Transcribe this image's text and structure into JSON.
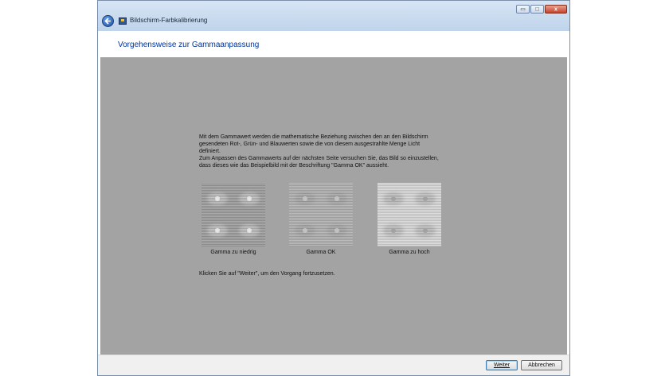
{
  "window": {
    "title": "Bildschirm-Farbkalibrierung",
    "controls": {
      "minimize": "▭",
      "maximize": "□",
      "close": "x"
    }
  },
  "page": {
    "heading": "Vorgehensweise zur Gammaanpassung",
    "description": "Mit dem Gammawert werden die mathematische Beziehung zwischen den an den Bildschirm\ngesendeten Rot-, Grün- und Blauwerten sowie die von diesem ausgestrahlte Menge Licht\ndefiniert.\nZum Anpassen des Gammawerts auf der nächsten Seite versuchen Sie, das Bild so einzustellen,\ndass dieses wie das Beispielbild mit der Beschriftung \"Gamma OK\" aussieht.",
    "samples": [
      {
        "label": "Gamma zu niedrig"
      },
      {
        "label": "Gamma OK"
      },
      {
        "label": "Gamma zu hoch"
      }
    ],
    "hint": "Klicken Sie auf \"Weiter\", um den Vorgang fortzusetzen."
  },
  "footer": {
    "next_label": "Weiter",
    "cancel_label": "Abbrechen"
  },
  "colors": {
    "heading": "#003399",
    "content_background": "#a3a3a3"
  }
}
